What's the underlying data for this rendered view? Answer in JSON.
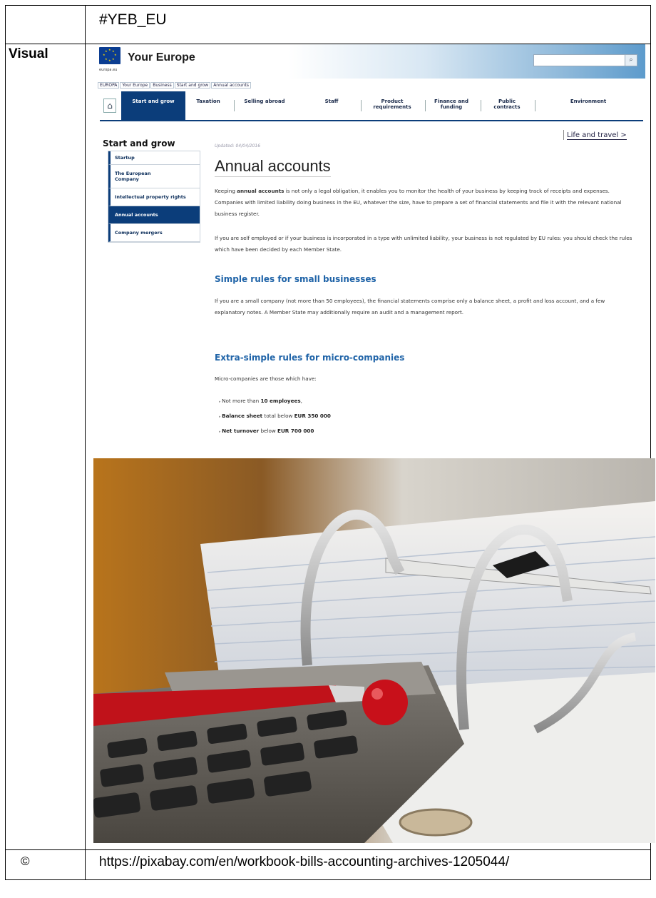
{
  "header_cell": {
    "hashtag": "#YEB_EU"
  },
  "visual_label": "Visual",
  "copyright": {
    "symbol": "©",
    "url": "https://pixabay.com/en/workbook-bills-accounting-archives-1205044/"
  },
  "screenshot": {
    "site_url": "europa.eu",
    "site_title": "Your Europe",
    "search_icon": "magnifier-icon",
    "breadcrumbs": [
      "EUROPA",
      "Your Europe",
      "Business",
      "Start and grow",
      "Annual accounts"
    ],
    "nav": [
      {
        "label": "Start and grow",
        "active": true
      },
      {
        "label": "Taxation"
      },
      {
        "label": "Selling abroad"
      },
      {
        "label": "Staff"
      },
      {
        "label": "Product requirements"
      },
      {
        "label": "Finance and funding"
      },
      {
        "label": "Public contracts"
      },
      {
        "label": "Environment"
      }
    ],
    "life_link": "Life and travel >",
    "sidebar_title": "Start and grow",
    "sidebar_items": [
      {
        "label": "Startup"
      },
      {
        "label": "The European Company"
      },
      {
        "label": "Intellectual property rights"
      },
      {
        "label": "Annual accounts",
        "active": true
      },
      {
        "label": "Company mergers"
      }
    ],
    "updated": "Updated: 04/04/2016",
    "title": "Annual accounts",
    "intro_pre": "Keeping ",
    "intro_bold": "annual accounts",
    "intro_post": " is not only a legal obligation, it enables you to monitor the health of your business by keeping track of receipts and expenses. Companies with limited liability doing business in the EU, whatever the size, have to prepare a set of financial statements and file it with the relevant national business register.",
    "para2": "If you are self employed or if your business is incorporated in a type with unlimited liability, your business is not regulated by EU rules: you should check the rules which have been decided by each Member State.",
    "h_small": "Simple rules for small businesses",
    "para3": "If you are a small company (not more than 50 employees), the financial statements comprise only a balance sheet, a profit and loss account, and a few explanatory notes. A Member State may additionally require an audit and a management report.",
    "h_micro": "Extra-simple rules for micro-companies",
    "para4": "Micro-companies are those which have:",
    "bullet1_pre": "Not more than ",
    "bullet1_bold": "10 employees",
    "bullet1_post": ",",
    "bullet2_bold": "Balance sheet",
    "bullet2_mid": " total below ",
    "bullet2_bold2": "EUR 350 000",
    "bullet3_bold": "Net turnover",
    "bullet3_mid": " below ",
    "bullet3_bold2": "EUR 700 000"
  }
}
